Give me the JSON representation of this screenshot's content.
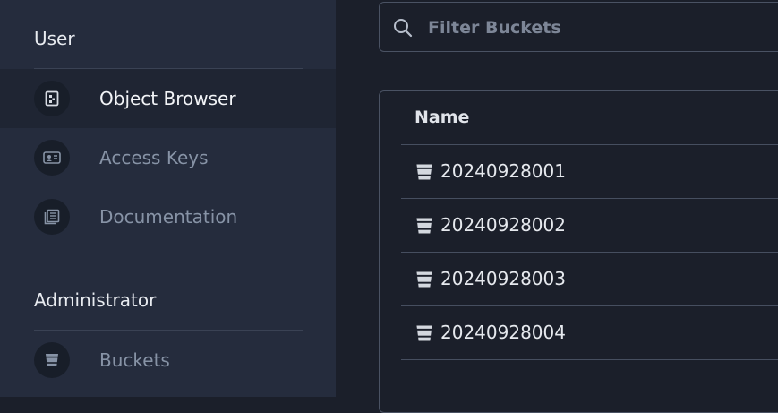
{
  "sidebar": {
    "user_section": "User",
    "admin_section": "Administrator",
    "items": [
      {
        "label": "Object Browser",
        "icon": "object-browser-icon",
        "active": true
      },
      {
        "label": "Access Keys",
        "icon": "access-keys-icon",
        "active": false
      },
      {
        "label": "Documentation",
        "icon": "documentation-icon",
        "active": false
      },
      {
        "label": "Buckets",
        "icon": "bucket-icon",
        "active": false
      }
    ]
  },
  "search": {
    "placeholder": "Filter Buckets",
    "value": ""
  },
  "table": {
    "header_name": "Name",
    "rows": [
      {
        "name": "20240928001"
      },
      {
        "name": "20240928002"
      },
      {
        "name": "20240928003"
      },
      {
        "name": "20240928004"
      }
    ]
  },
  "colors": {
    "sidebar_bg": "#252c3d",
    "main_bg": "#1b1f2a",
    "active_item_bg": "#1f2533",
    "muted_text": "#8793a6"
  }
}
